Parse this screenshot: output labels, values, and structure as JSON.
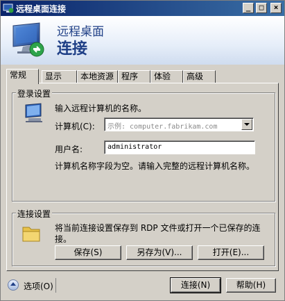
{
  "window": {
    "title": "远程桌面连接",
    "min_label": "_",
    "max_label": "□",
    "close_label": "×"
  },
  "header": {
    "line1": "远程桌面",
    "line2": "连接"
  },
  "tabs": [
    "常规",
    "显示",
    "本地资源",
    "程序",
    "体验",
    "高级"
  ],
  "login": {
    "group_label": "登录设置",
    "instruction": "输入远程计算机的名称。",
    "computer_label": "计算机(C):",
    "computer_placeholder": "示例: computer.fabrikam.com",
    "username_label": "用户名:",
    "username_value": "administrator",
    "status": "计算机名称字段为空。请输入完整的远程计算机名称。"
  },
  "connection": {
    "group_label": "连接设置",
    "description_line1": "将当前连接设置保存到 RDP 文件或打开一个已保存的连",
    "description_line2": "接。",
    "save_label": "保存(S)",
    "save_as_label": "另存为(V)...",
    "open_label": "打开(E)..."
  },
  "footer": {
    "options_label": "选项(O)",
    "connect_label": "连接(N)",
    "help_label": "帮助(H)"
  }
}
